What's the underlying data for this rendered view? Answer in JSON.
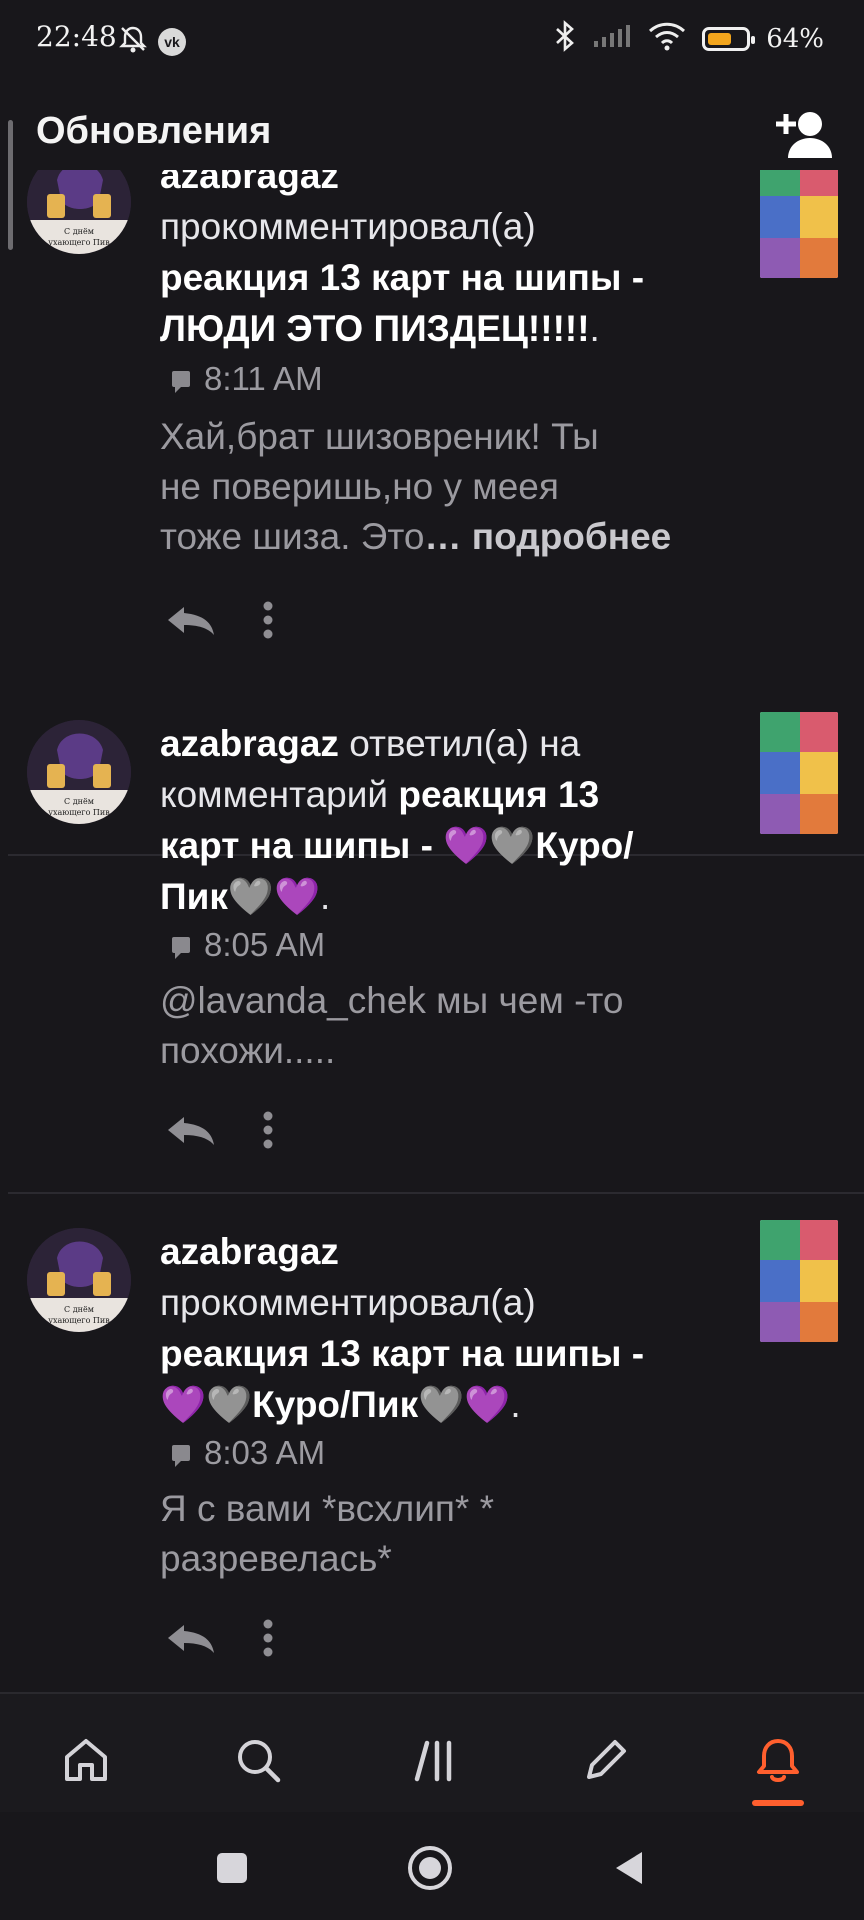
{
  "status_bar": {
    "time": "22:48",
    "battery_text": "64%",
    "battery_level": 0.64,
    "icons": [
      "dnd-bell-off-icon",
      "vk-icon",
      "bluetooth-icon",
      "signal-icon",
      "wifi-icon",
      "battery-icon"
    ],
    "vk_label": "vk"
  },
  "header": {
    "title": "Обновления",
    "add_user_icon": "add-user-icon"
  },
  "colors": {
    "background": "#18171b",
    "accent": "#ff5f2e",
    "text": "#e6e6ea",
    "muted": "#9b9aa0"
  },
  "avatar": {
    "caption_line1": "С днём",
    "caption_line2": "ухающего Пив"
  },
  "feed": [
    {
      "user": "azabragaz",
      "action": "прокомментировал(а)",
      "post_line1": "реакция 13 карт на шипы -",
      "post_line2": "ЛЮДИ ЭТО ПИЗДЕЦ!!!!!",
      "suffix": ".",
      "time": "8:11 AM",
      "excerpt_line1": "Хай,брат шизовреник! Ты",
      "excerpt_line2": "не поверишь,но у меея",
      "excerpt_line3": "тоже шиза. Это",
      "ellipsis": "…",
      "more": "подробнее"
    },
    {
      "user": "azabragaz",
      "action": "ответил(а) на",
      "action_line2": "комментарий",
      "post_line1": "реакция 13",
      "post_line2": "карт на шипы -",
      "post_line2_tail": "Куро/",
      "post_line3": "Пик",
      "suffix": ".",
      "time": "8:05 AM",
      "excerpt_line1": "@lavanda_chek мы чем -то",
      "excerpt_line2": "похожи....."
    },
    {
      "user": "azabragaz",
      "action": "прокомментировал(а)",
      "post_line1": "реакция 13 карт на шипы -",
      "post_line2": "Куро/Пик",
      "suffix": ".",
      "time": "8:03 AM",
      "excerpt_line1": "Я с вами *всхлип* *",
      "excerpt_line2": "разревелась*"
    }
  ],
  "bottom_nav": {
    "items": [
      "home-icon",
      "search-icon",
      "feed-icon",
      "edit-icon",
      "bell-icon"
    ],
    "active": "bell-icon"
  }
}
